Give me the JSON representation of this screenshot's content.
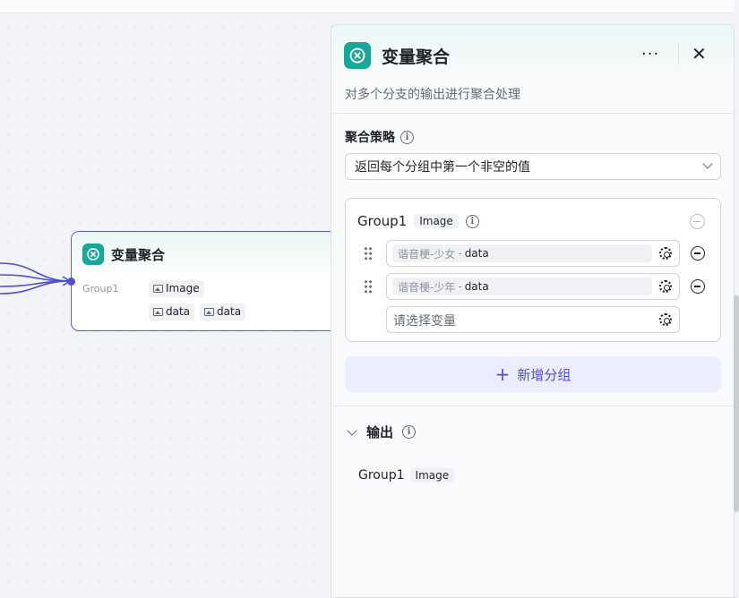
{
  "node": {
    "title": "变量聚合",
    "group_label": "Group1",
    "group_type": "Image",
    "vars": [
      "data",
      "data"
    ]
  },
  "panel": {
    "title": "变量聚合",
    "description": "对多个分支的输出进行聚合处理",
    "more_label": "···",
    "close_label": "✕",
    "strategy": {
      "label": "聚合策略",
      "info": "i",
      "selected": "返回每个分组中第一个非空的值"
    },
    "group": {
      "name": "Group1",
      "type": "Image",
      "info": "i",
      "variables": [
        {
          "source": "谐音梗-少女",
          "sep": "-",
          "name": "data"
        },
        {
          "source": "谐音梗-少年",
          "sep": "-",
          "name": "data"
        }
      ],
      "select_placeholder": "请选择变量"
    },
    "add_group": {
      "icon": "+",
      "label": "新增分组"
    },
    "output": {
      "label": "输出",
      "info": "i",
      "rows": [
        {
          "name": "Group1",
          "type": "Image"
        }
      ]
    }
  },
  "colors": {
    "accent": "#4e4fd6",
    "brand_teal": "#17a89a",
    "add_group_bg": "#eceeff"
  }
}
